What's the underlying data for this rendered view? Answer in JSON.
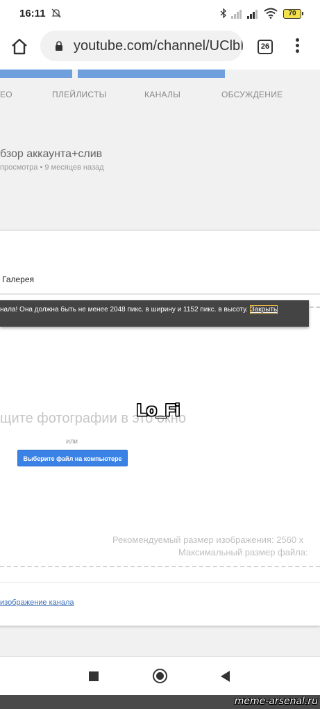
{
  "status_bar": {
    "time": "16:11",
    "battery": "70",
    "icons": [
      "muted-notifications-icon",
      "bluetooth-icon",
      "signal-icon",
      "signal-icon",
      "wifi-icon",
      "battery-icon"
    ]
  },
  "browser": {
    "url": "youtube.com/channel/UClbI",
    "tab_count": "26",
    "icons": [
      "home-icon",
      "lock-icon",
      "menu-icon"
    ]
  },
  "channel_tabs": [
    "ЕО",
    "ПЛЕЙЛИСТЫ",
    "КАНАЛЫ",
    "ОБСУЖДЕНИЕ"
  ],
  "video": {
    "title": "бзор аккаунта+слив",
    "meta": "просмотра • 9 месяцев назад"
  },
  "dialog": {
    "gallery_label": "Галерея",
    "toast_text": "нала! Она должна быть не менее 2048 пикс. в ширину и 1152 пикс. в высоту.",
    "toast_close": "Закрыть",
    "drop_text": "щите фотографии в это окно",
    "or_text": "или",
    "choose_button": "Выберите файл на компьютере",
    "recommended_size": "Рекомендуемый размер изображения: 2560 х",
    "max_size": "Максимальный размер файла:",
    "channel_image_link": "изображение канала"
  },
  "overlay": {
    "watermark_text": "Lo_Fi",
    "site_watermark": "meme-arsenal.ru"
  },
  "nav_bar": {
    "icons": [
      "recents-icon",
      "home-circle-icon",
      "back-icon"
    ]
  }
}
